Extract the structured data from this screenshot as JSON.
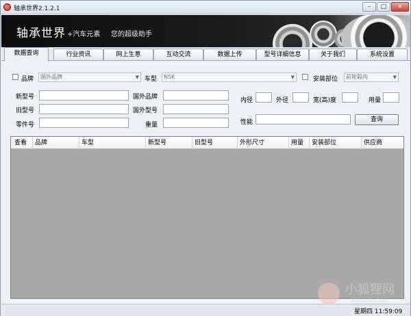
{
  "window": {
    "title": "轴承世界2.1.2.1",
    "controls": {
      "minimize": "–",
      "maximize": "□",
      "close": "✕"
    }
  },
  "banner": {
    "title": "轴承世界",
    "subtitle": "+汽车元素",
    "slogan": "您的超级助手"
  },
  "tabs": [
    {
      "label": "数据查询",
      "active": true
    },
    {
      "label": "行业资讯",
      "active": false
    },
    {
      "label": "网上生意",
      "active": false
    },
    {
      "label": "互动交流",
      "active": false
    },
    {
      "label": "数据上传",
      "active": false
    },
    {
      "label": "型号详细信息",
      "active": false
    },
    {
      "label": "关于我们",
      "active": false
    },
    {
      "label": "系统设置",
      "active": false
    }
  ],
  "filters": {
    "brand_label": "品牌",
    "brand_value": "国外品牌",
    "car_type_label": "车型",
    "car_type_value": "NSK",
    "install_label": "安装部位",
    "install_value": "前轮毂内"
  },
  "fields": {
    "new_model": "新型号",
    "foreign_brand": "国外品牌",
    "old_model": "旧型号",
    "foreign_model": "国外型号",
    "part_no": "零件号",
    "weight": "重量",
    "inner_dia": "内径",
    "outer_dia": "外径",
    "width": "宽(高)度",
    "usage": "用量",
    "performance": "性能"
  },
  "buttons": {
    "query": "查询"
  },
  "grid": {
    "columns": [
      "查看",
      "品牌",
      "车型",
      "新型号",
      "旧型号",
      "外形尺寸",
      "用量",
      "安装部位",
      "供应商"
    ]
  },
  "status": {
    "time": "星期四 11:59:09"
  },
  "watermark": {
    "text": "小狐狸网",
    "url": "XIUXS.CN"
  }
}
